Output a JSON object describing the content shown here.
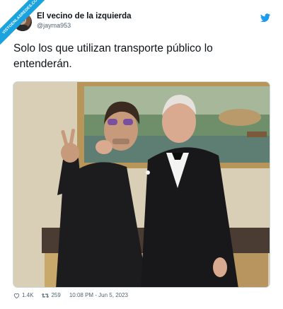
{
  "ribbon": {
    "text": "VISTOENLASREDES.COM"
  },
  "author": {
    "name": "El vecino de la izquierda",
    "handle": "@jayma953"
  },
  "tweet": {
    "text": "Solo los que utilizan transporte público lo entenderán."
  },
  "stats": {
    "likes": "1.4K",
    "retweets": "259",
    "timestamp": "10:08 PM - Jun 5, 2023"
  },
  "colors": {
    "brand": "#1d9bf0",
    "ribbon": "#1aa3e0",
    "muted": "#536471"
  },
  "icons": [
    "twitter-bird-icon",
    "heart-icon",
    "retweet-icon"
  ]
}
